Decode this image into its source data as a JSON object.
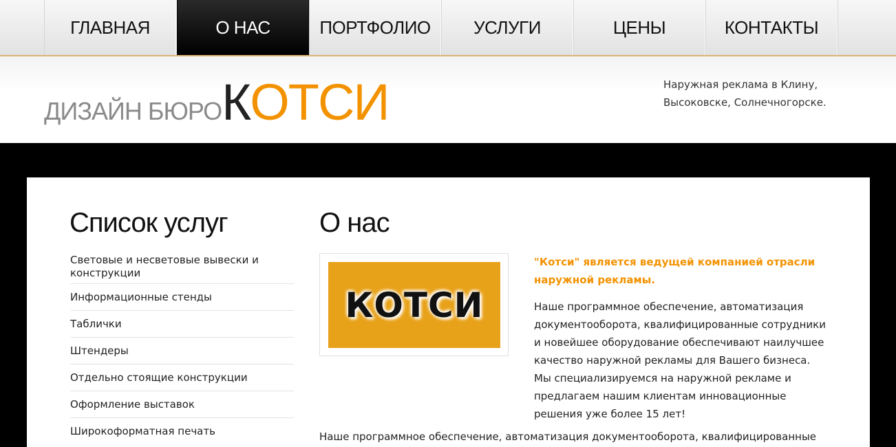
{
  "nav": {
    "items": [
      {
        "label": "ГЛАВНАЯ",
        "active": false
      },
      {
        "label": "О НАС",
        "active": true
      },
      {
        "label": "ПОРТФОЛИО",
        "active": false
      },
      {
        "label": "УСЛУГИ",
        "active": false
      },
      {
        "label": "ЦЕНЫ",
        "active": false
      },
      {
        "label": "КОНТАКТЫ",
        "active": false
      }
    ]
  },
  "header": {
    "logo_prefix": "ДИЗАЙН БЮРО",
    "logo_first_letter": "К",
    "logo_rest": "ОТСИ",
    "tagline_line1": "Наружная реклама в Клину,",
    "tagline_line2": "Высоковске, Солнечногорске."
  },
  "sidebar": {
    "title": "Список услуг",
    "items": [
      {
        "label": "Световые и несветовые вывески и конструкции"
      },
      {
        "label": "Информационные стенды"
      },
      {
        "label": "Таблички"
      },
      {
        "label": "Штендеры"
      },
      {
        "label": "Отдельно стоящие конструкции"
      },
      {
        "label": "Оформление выставок"
      },
      {
        "label": "Широкоформатная печать"
      }
    ]
  },
  "main": {
    "title": "О нас",
    "image_text": "КОТСИ",
    "lead": "\"Котси\" является ведущей компанией отрасли наружной рекламы.",
    "paragraph1": "Наше программное обеспечение, автоматизация документооборота, квалифицированные сотрудники и новейшее оборудование обеспечивают наилучшее качество наружной рекламы для Вашего бизнеса. Мы специализируемся на наружной рекламе и предлагаем нашим клиентам инновационные решения уже более 15 лет!",
    "paragraph2": "Наше программное обеспечение, автоматизация документооборота, квалифицированные"
  },
  "colors": {
    "accent": "#f39200",
    "nav_active_bg": "#000000",
    "page_bg": "#000000",
    "image_bg": "#e8a21a"
  }
}
